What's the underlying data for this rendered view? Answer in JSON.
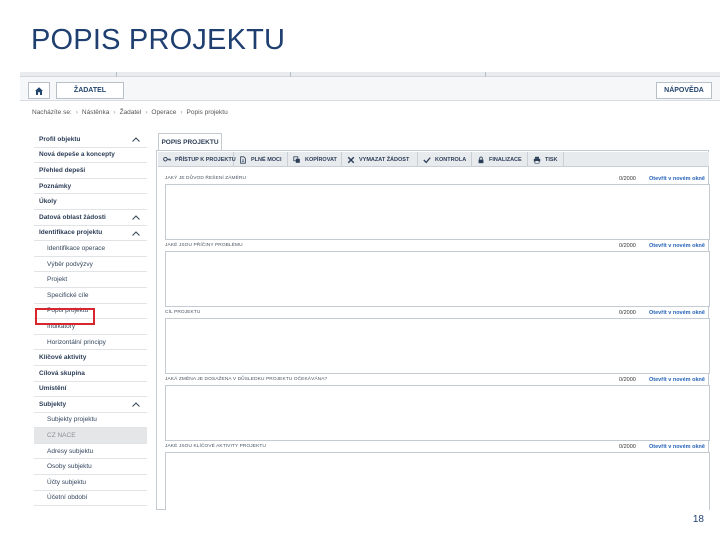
{
  "slide": {
    "title": "POPIS PROJEKTU",
    "page_number": "18"
  },
  "header": {
    "zadatel_label": "ŽADATEL",
    "napoveda_label": "NÁPOVĚDA"
  },
  "breadcrumb": {
    "label": "Nacházíte se:",
    "items": [
      "Nástěnka",
      "Žadatel",
      "Operace",
      "Popis projektu"
    ]
  },
  "sidebar": {
    "items": [
      {
        "label": "Profil objektu",
        "kind": "sec",
        "chevron": true
      },
      {
        "label": "Nová depeše a koncepty",
        "kind": "sec",
        "chevron": false
      },
      {
        "label": "Přehled depeší",
        "kind": "sec",
        "chevron": false
      },
      {
        "label": "Poznámky",
        "kind": "sec",
        "chevron": false
      },
      {
        "label": "Úkoly",
        "kind": "sec",
        "chevron": false
      },
      {
        "label": "Datová oblast žádosti",
        "kind": "sec",
        "chevron": true
      },
      {
        "label": "Identifikace projektu",
        "kind": "sec",
        "chevron": true
      },
      {
        "label": "Identifikace operace",
        "kind": "sub",
        "chevron": false
      },
      {
        "label": "Výběr podvýzvy",
        "kind": "sub",
        "chevron": false
      },
      {
        "label": "Projekt",
        "kind": "sub",
        "chevron": false
      },
      {
        "label": "Specifické cíle",
        "kind": "sub",
        "chevron": false
      },
      {
        "label": "Popis projektu",
        "kind": "sub",
        "chevron": false
      },
      {
        "label": "Indikátory",
        "kind": "sub",
        "chevron": false
      },
      {
        "label": "Horizontální principy",
        "kind": "sub",
        "chevron": false
      },
      {
        "label": "Klíčové aktivity",
        "kind": "sec",
        "chevron": false
      },
      {
        "label": "Cílová skupina",
        "kind": "sec",
        "chevron": false
      },
      {
        "label": "Umístění",
        "kind": "sec",
        "chevron": false
      },
      {
        "label": "Subjekty",
        "kind": "sec",
        "chevron": true
      },
      {
        "label": "Subjekty projektu",
        "kind": "sub",
        "chevron": false
      },
      {
        "label": "CZ NACE",
        "kind": "gray",
        "chevron": false
      },
      {
        "label": "Adresy subjektu",
        "kind": "sub",
        "chevron": false
      },
      {
        "label": "Osoby subjektu",
        "kind": "sub",
        "chevron": false
      },
      {
        "label": "Účty subjektu",
        "kind": "sub",
        "chevron": false
      },
      {
        "label": "Účetní období",
        "kind": "sub",
        "chevron": false
      }
    ]
  },
  "tab": {
    "label": "POPIS PROJEKTU"
  },
  "toolbar": {
    "items": [
      {
        "label": "PŘÍSTUP K PROJEKTU",
        "icon": "key-icon"
      },
      {
        "label": "PLNÉ MOCI",
        "icon": "document-icon"
      },
      {
        "label": "KOPÍROVAT",
        "icon": "copy-icon"
      },
      {
        "label": "VYMAZAT ŽÁDOST",
        "icon": "delete-icon"
      },
      {
        "label": "KONTROLA",
        "icon": "check-icon"
      },
      {
        "label": "FINALIZACE",
        "icon": "lock-icon"
      },
      {
        "label": "TISK",
        "icon": "print-icon"
      }
    ]
  },
  "fields": [
    {
      "label": "JAKÝ JE DŮVOD ŘEŠENÍ ZÁMĚRU",
      "count": "0/2000",
      "link": "Otevřít v novém okně"
    },
    {
      "label": "JAKÉ JSOU PŘÍČINY PROBLÉMU",
      "count": "0/2000",
      "link": "Otevřít v novém okně"
    },
    {
      "label": "CÍL PROJEKTU",
      "count": "0/2000",
      "link": "Otevřít v novém okně"
    },
    {
      "label": "JAKÁ ZMĚNA JE DOSAŽENA V DŮSLEDKU PROJEKTU OČEKÁVÁNA?",
      "count": "0/2000",
      "link": "Otevřít v novém okně"
    },
    {
      "label": "JAKÉ JSOU KLÍČOVÉ AKTIVITY PROJEKTU",
      "count": "0/2000",
      "link": "Otevřít v novém okně"
    }
  ]
}
